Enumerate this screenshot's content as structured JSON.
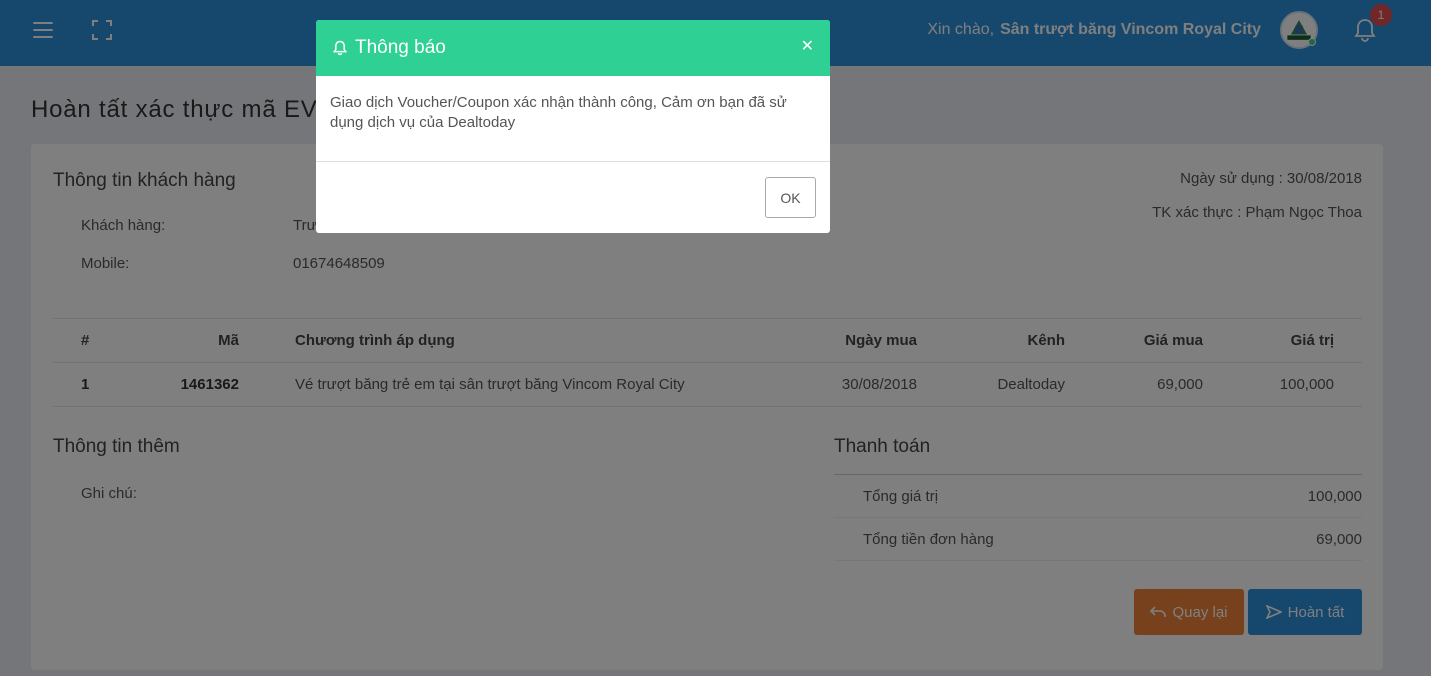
{
  "header": {
    "greeting_prefix": "Xin chào,",
    "user_name": "Sân trượt băng Vincom Royal City",
    "notification_count": "1",
    "brand_color": "#2c8fdb"
  },
  "page": {
    "title": "Hoàn tất xác thực mã EVoucher"
  },
  "customer": {
    "section_title": "Thông tin khách hàng",
    "customer_label": "Khách hàng:",
    "customer_value": "Trương Long",
    "mobile_label": "Mobile:",
    "mobile_value": "01674648509",
    "usage_date": "Ngày sử dụng : 30/08/2018",
    "verifier": "TK xác thực : Phạm Ngọc Thoa"
  },
  "table": {
    "columns": [
      "#",
      "Mã",
      "Chương trình áp dụng",
      "Ngày mua",
      "Kênh",
      "Giá mua",
      "Giá trị"
    ],
    "rows": [
      [
        "1",
        "1461362",
        "Vé trượt băng trẻ em tại sân trượt băng Vincom Royal City",
        "30/08/2018",
        "Dealtoday",
        "69,000",
        "100,000"
      ]
    ]
  },
  "extra": {
    "section_title": "Thông tin thêm",
    "note_label": "Ghi chú:"
  },
  "payment": {
    "section_title": "Thanh toán",
    "total_value_label": "Tổng giá trị",
    "total_value": "100,000",
    "order_total_label": "Tổng tiền đơn hàng",
    "order_total": "69,000"
  },
  "buttons": {
    "back": "Quay lại",
    "done": "Hoàn tất",
    "back_color": "#f0833a",
    "done_color": "#2c8fdb"
  },
  "modal": {
    "title": "Thông báo",
    "message": "Giao dịch Voucher/Coupon xác nhận thành công, Cảm ơn bạn đã sử dụng dịch vụ của Dealtoday",
    "ok_label": "OK",
    "header_color": "#2ed094"
  }
}
